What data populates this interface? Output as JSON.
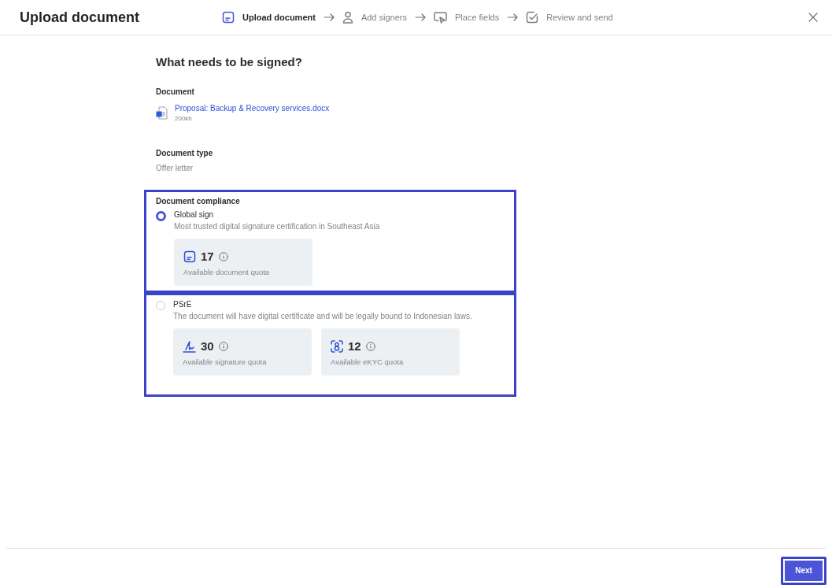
{
  "header": {
    "title": "Upload document",
    "steps": [
      {
        "label": "Upload document",
        "kind": "document",
        "selected": true
      },
      {
        "label": "Add signers",
        "kind": "person",
        "selected": false
      },
      {
        "label": "Place fields",
        "kind": "pointer",
        "selected": false
      },
      {
        "label": "Review and send",
        "kind": "check",
        "selected": false
      }
    ]
  },
  "form": {
    "heading": "What needs to be signed?",
    "document": {
      "label": "Document",
      "file_name": "Proposal: Backup & Recovery services.docx",
      "file_size": "200kb"
    },
    "document_type": {
      "label": "Document type",
      "value": "Offer letter"
    },
    "compliance": {
      "label": "Document compliance",
      "options": [
        {
          "title": "Global sign",
          "description": "Most trusted digital signature certification in Southeast Asia",
          "selected": true,
          "quotas": [
            {
              "kind": "document",
              "count": "17",
              "label": "Available document quota"
            }
          ]
        },
        {
          "title": "PSrE",
          "description": "The document will have digital certificate and will be legally bound to Indonesian laws.",
          "selected": false,
          "quotas": [
            {
              "kind": "signature",
              "count": "30",
              "label": "Available signature quota"
            },
            {
              "kind": "face",
              "count": "12",
              "label": "Available eKYC quota"
            }
          ]
        }
      ]
    }
  },
  "footer": {
    "next_button": "Next"
  }
}
